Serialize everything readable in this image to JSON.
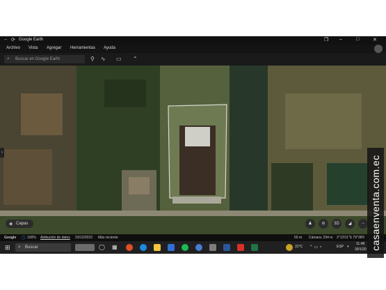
{
  "window": {
    "title": "Google Earth"
  },
  "titlebar": {
    "back_icon": "arrow-left-icon",
    "reload_icon": "reload-icon",
    "controls": [
      "restore",
      "minimize",
      "maximize",
      "close"
    ]
  },
  "menu": {
    "items": [
      "Archivo",
      "Vista",
      "Agregar",
      "Herramientas",
      "Ayuda"
    ]
  },
  "toolbar": {
    "search_placeholder": "Buscar en Google Earth",
    "tools": [
      "pin-icon",
      "path-icon",
      "measure-icon",
      "chevron-up-icon"
    ]
  },
  "map": {
    "layers_label": "Capas",
    "scale_label": "50 m",
    "controls": [
      "person-icon",
      "compass-icon",
      "3D",
      "zoom-out-icon"
    ]
  },
  "status": {
    "brand": "Google",
    "zoom": "100%",
    "attribution": "Atribución de datos",
    "date": "23/12/2022",
    "recent": "Más reciente",
    "camera": "Cámara: 294 m",
    "coords": "2°13'01\"S 79°38'0"
  },
  "taskbar": {
    "search_label": "Buscar",
    "temperature": "31°C",
    "language": "ESP",
    "time": "11:48",
    "date": "30/1/20"
  },
  "watermark": {
    "text": "casaenventa.com.ec"
  }
}
